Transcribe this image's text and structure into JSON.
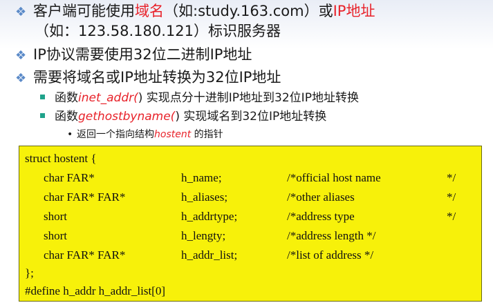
{
  "bullets": [
    {
      "text_pre": "客户端可能使用",
      "text_red": "域名",
      "text_mid": "（如:study.163.com）或",
      "text_red2": "IP地址",
      "text_cont": "（如：123.58.180.121）标识服务器"
    },
    {
      "text": "IP协议需要使用32位二进制IP地址"
    },
    {
      "text": "需要将域名或IP地址转换为32位IP地址"
    }
  ],
  "sub_bullets": [
    {
      "pre": "函数",
      "func": "inet_addr(",
      "post": ") 实现点分十进制IP地址到32位IP地址转换"
    },
    {
      "pre": "函数",
      "func": "gethostbyname(",
      "post": ") 实现域名到32位IP地址转换"
    }
  ],
  "sub_sub_bullet": {
    "pre": "返回一个指向结构",
    "func": "hostent",
    "post": " 的指针"
  },
  "bullet_glyph": "❖",
  "sub_sub_glyph": "•",
  "code": {
    "open": "struct hostent {",
    "rows": [
      {
        "type": "char FAR*",
        "name": "h_name;",
        "comment": "/*official host name",
        "end": "*/"
      },
      {
        "type": "char FAR* FAR*",
        "name": "h_aliases;",
        "comment": "/*other aliases",
        "end": "*/"
      },
      {
        "type": "short",
        "name": "h_addrtype;",
        "comment": "/*address type",
        "end": "*/"
      },
      {
        "type": "short",
        "name": "h_lengty;",
        "comment": "/*address length */",
        "end": ""
      },
      {
        "type": "char FAR* FAR*",
        "name": "h_addr_list;",
        "comment": "/*list of address   */",
        "end": ""
      }
    ],
    "close": "};",
    "define": "#define h_addr h_addr_list[0]"
  },
  "colors": {
    "accent_red": "#e8222a",
    "code_bg": "#f7f10a",
    "bullet_blue": "#5b8ac8",
    "square_teal": "#1fa38b"
  }
}
